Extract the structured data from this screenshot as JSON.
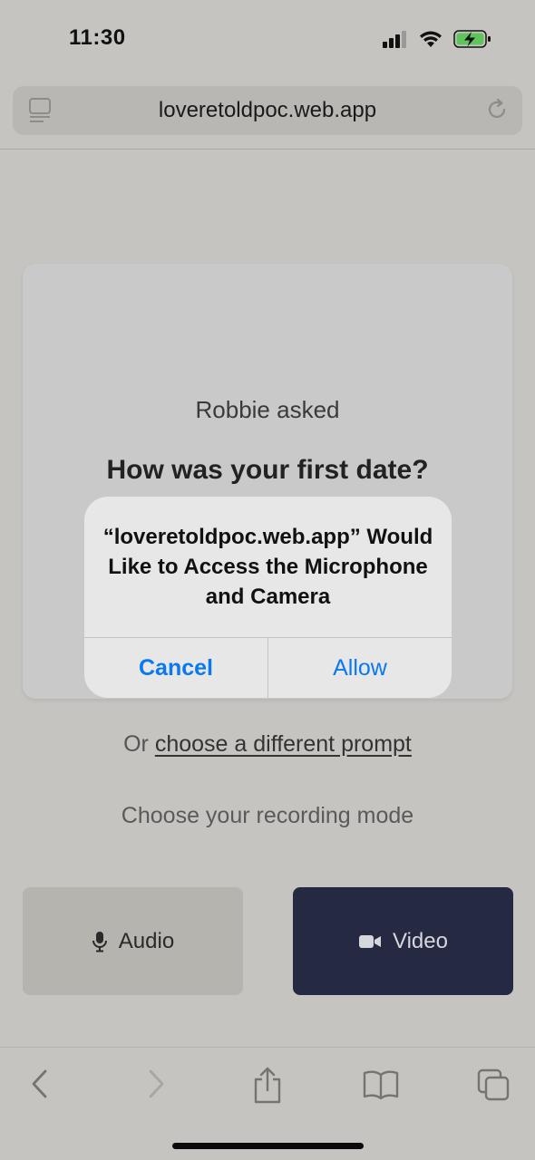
{
  "status_bar": {
    "time": "11:30",
    "icons": [
      "cellular-signal-icon",
      "wifi-icon",
      "battery-charging-icon"
    ],
    "battery_color": "#5fc45b"
  },
  "browser": {
    "url": "loveretoldpoc.web.app",
    "icons": [
      "reader-icon",
      "reload-icon"
    ]
  },
  "prompt_card": {
    "asked_by": "Robbie asked",
    "question": "How was your first date?"
  },
  "permission_alert": {
    "message": "“loveretoldpoc.web.app” Would Like to Access the Microphone and Camera",
    "cancel_label": "Cancel",
    "allow_label": "Allow",
    "button_color": "#0a78f0"
  },
  "alt_prompt": {
    "prefix": "Or ",
    "link_text": "choose a different prompt"
  },
  "recording": {
    "label": "Choose your recording mode",
    "modes": [
      {
        "label": "Audio",
        "icon": "microphone-icon",
        "selected": false
      },
      {
        "label": "Video",
        "icon": "video-camera-icon",
        "selected": true
      }
    ],
    "selected_color": "#252941"
  },
  "toolbar": {
    "icons": [
      "back-icon",
      "forward-icon",
      "share-icon",
      "bookmarks-icon",
      "tabs-icon"
    ]
  }
}
